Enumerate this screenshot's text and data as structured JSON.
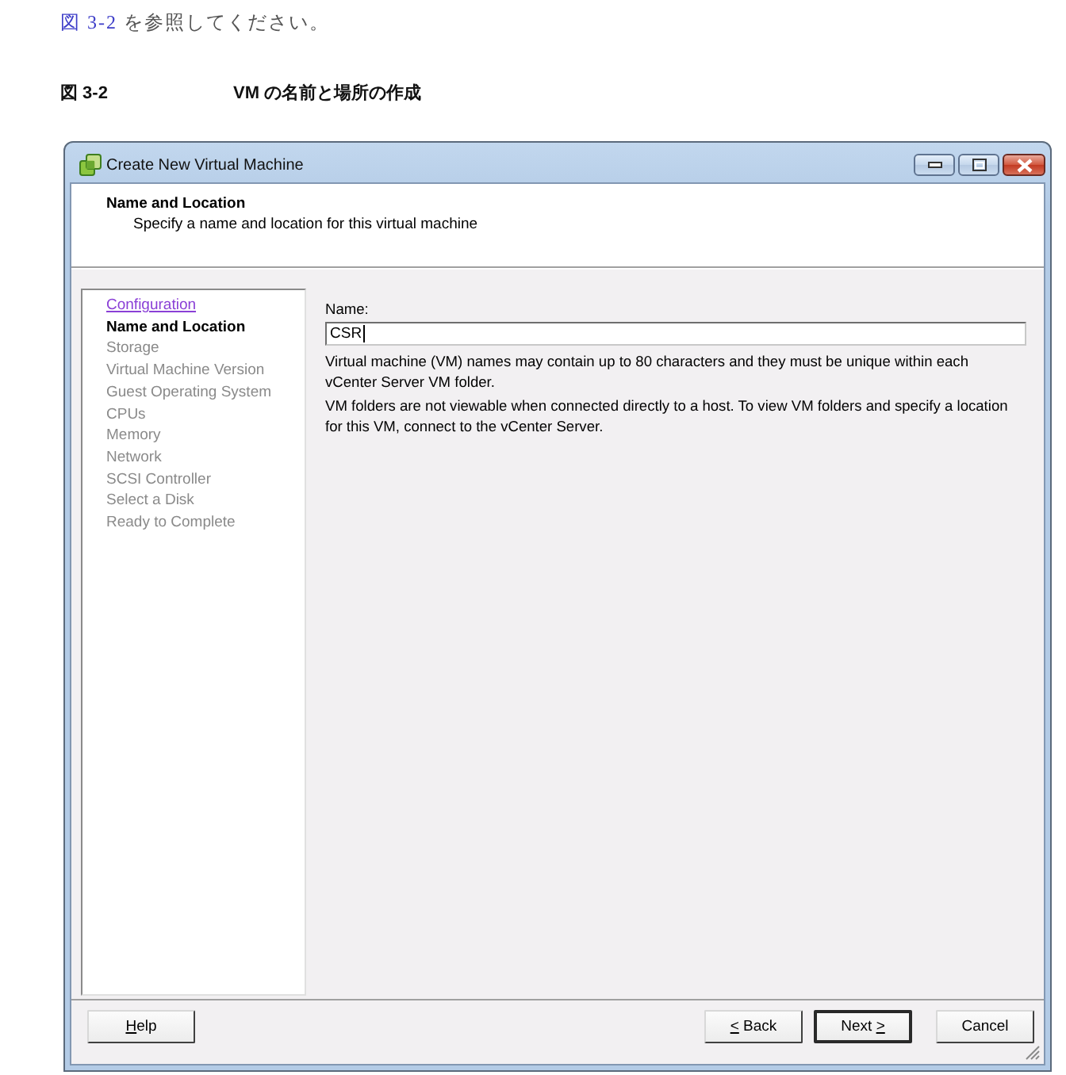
{
  "intro": {
    "link": "図 3-2",
    "text": "を参照してください。"
  },
  "caption": {
    "number": "図 3-2",
    "title": "VM の名前と場所の作成"
  },
  "window": {
    "title": "Create New Virtual Machine"
  },
  "header": {
    "title": "Name and Location",
    "subtitle": "Specify a name and location for this virtual machine"
  },
  "steps": [
    {
      "kind": "link",
      "label": "Configuration",
      "selected": false,
      "disabled": false
    },
    {
      "kind": "step",
      "label": "Name and Location",
      "selected": true,
      "disabled": false
    },
    {
      "kind": "step",
      "label": "Storage",
      "selected": false,
      "disabled": true
    },
    {
      "kind": "step",
      "label": "Virtual Machine Version",
      "selected": false,
      "disabled": true
    },
    {
      "kind": "step",
      "label": "Guest Operating System",
      "selected": false,
      "disabled": true
    },
    {
      "kind": "step",
      "label": "CPUs",
      "selected": false,
      "disabled": true
    },
    {
      "kind": "step",
      "label": "Memory",
      "selected": false,
      "disabled": true
    },
    {
      "kind": "step",
      "label": "Network",
      "selected": false,
      "disabled": true
    },
    {
      "kind": "step",
      "label": "SCSI Controller",
      "selected": false,
      "disabled": true
    },
    {
      "kind": "step",
      "label": "Select a Disk",
      "selected": false,
      "disabled": true
    },
    {
      "kind": "step",
      "label": "Ready to Complete",
      "selected": false,
      "disabled": true
    }
  ],
  "name_field": {
    "label": "Name:",
    "value": "CSR",
    "focused": true
  },
  "notes": [
    "Virtual machine (VM) names may contain up to 80 characters and they must be unique within each vCenter Server VM folder.",
    "VM folders are not viewable when connected directly to a host. To view VM folders and specify a location for this VM, connect to the vCenter Server."
  ],
  "footer": {
    "help": {
      "mnemonic": "H",
      "label_end": "elp",
      "default": false
    },
    "navigation": [
      {
        "mnemonic": "<",
        "label_end": " Back",
        "default": false
      },
      {
        "label_start": "Next ",
        "mnemonic": ">",
        "default": true
      },
      {
        "label_start": "Cancel",
        "default": false
      }
    ]
  }
}
